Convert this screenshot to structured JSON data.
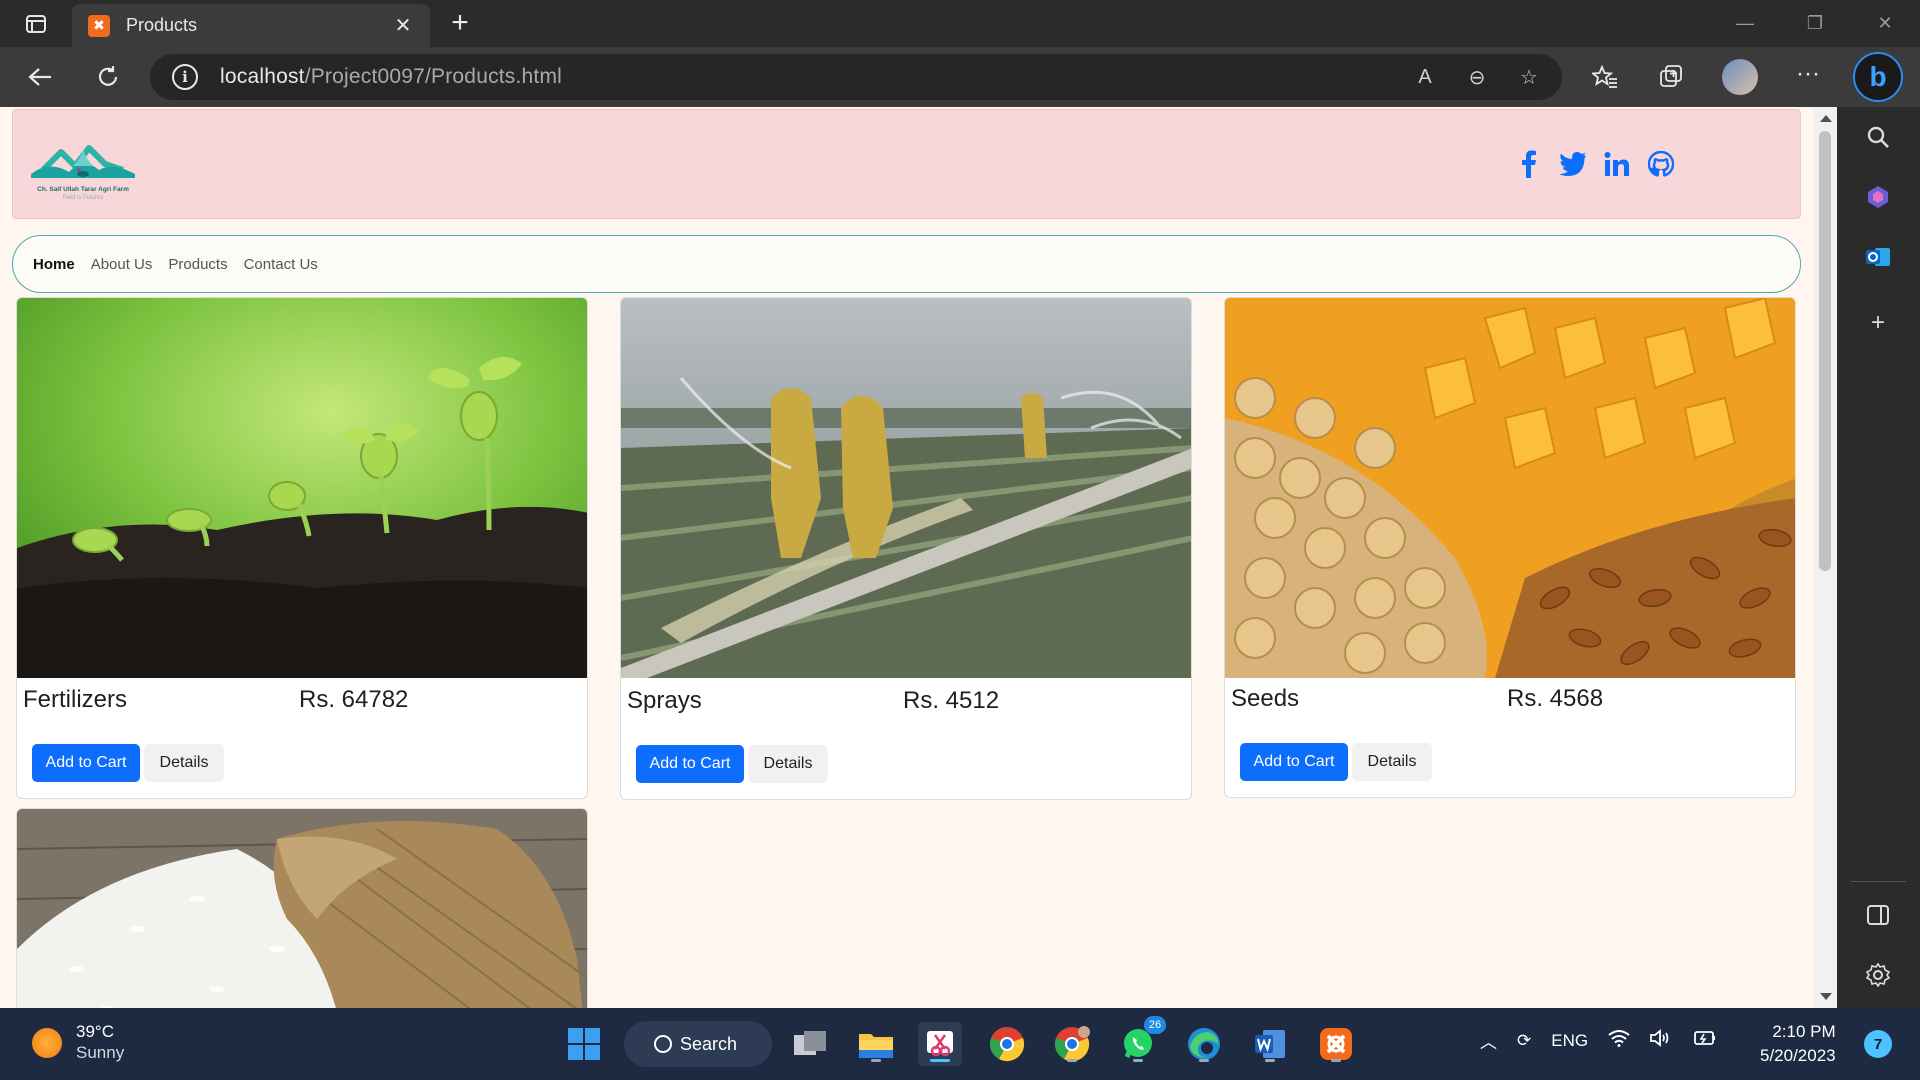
{
  "browser": {
    "tab_title": "Products",
    "new_tab_label": "+",
    "url_host": "localhost",
    "url_path": "/Project0097/Products.html"
  },
  "site": {
    "logo_name": "Ch. Saif Ullah Tarar Agri Farm",
    "logo_tagline": "Field is Futures",
    "social_icons": [
      "facebook-icon",
      "twitter-icon",
      "linkedin-icon",
      "github-icon"
    ],
    "nav": [
      {
        "label": "Home",
        "active": true
      },
      {
        "label": "About Us",
        "active": false
      },
      {
        "label": "Products",
        "active": false
      },
      {
        "label": "Contact Us",
        "active": false
      }
    ],
    "add_to_cart_label": "Add to Cart",
    "details_label": "Details"
  },
  "products": [
    {
      "name": "Fertilizers",
      "price": "Rs. 64782"
    },
    {
      "name": "Sprays",
      "price": "Rs. 4512"
    },
    {
      "name": "Seeds",
      "price": "Rs. 4568"
    },
    {
      "name": "",
      "price": ""
    }
  ],
  "taskbar": {
    "weather_temp": "39°C",
    "weather_cond": "Sunny",
    "search_label": "Search",
    "lang": "ENG",
    "time": "2:10 PM",
    "date": "5/20/2023",
    "notification_count": "7",
    "whatsapp_badge": "26"
  },
  "colors": {
    "header_bg": "#f8d7da",
    "page_bg": "#fff7ef",
    "primary": "#0d6efd",
    "nav_border": "#4ea8a8"
  }
}
